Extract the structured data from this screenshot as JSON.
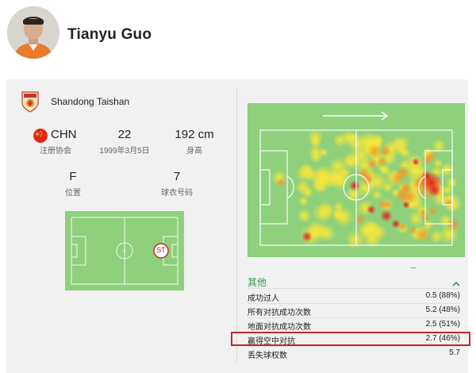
{
  "player": {
    "name": "Tianyu Guo"
  },
  "club": {
    "name": "Shandong Taishan",
    "logo_colors": [
      "#f28a1e",
      "#c2362b"
    ]
  },
  "info": {
    "nationality": {
      "value": "CHN",
      "label": "注册协会",
      "flag": "china-flag-icon"
    },
    "age": {
      "value": "22",
      "label": "1999年3月5日"
    },
    "height": {
      "value": "192 cm",
      "label": "身高"
    },
    "position": {
      "value": "F",
      "label": "位置"
    },
    "shirt": {
      "value": "7",
      "label": "球衣号码"
    },
    "pitch_position_badge": "ST"
  },
  "heatmap": {
    "direction_arrow": "arrow-right-icon",
    "pitch_color": "#8ed07c"
  },
  "stats": {
    "section_title": "其他",
    "collapse_icon": "chevron-up-icon",
    "rows": [
      {
        "label": "成功过人",
        "value": "0.5 (88%)"
      },
      {
        "label": "所有对抗成功次数",
        "value": "5.2 (48%)"
      },
      {
        "label": "地面对抗成功次数",
        "value": "2.5 (51%)"
      },
      {
        "label": "赢得空中对抗",
        "value": "2.7 (46%)",
        "highlighted": true
      },
      {
        "label": "丢失球权数",
        "value": "5.7"
      }
    ],
    "highlight_color": "#c6262b"
  },
  "colors": {
    "accent_green": "#2e9c4e",
    "card_bg": "#f1f1f1"
  }
}
